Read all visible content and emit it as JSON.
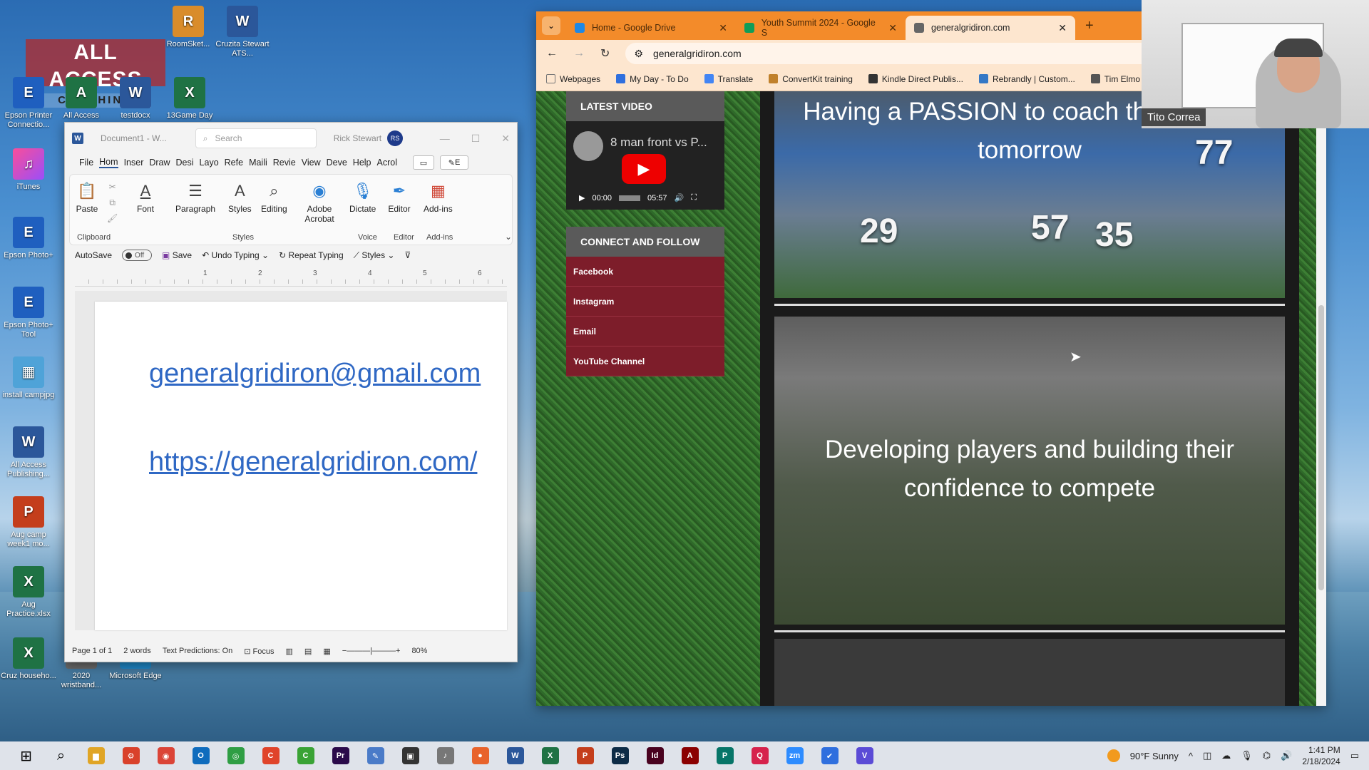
{
  "desktop": {
    "logo": {
      "line1": "ALL ACCESS",
      "line2": "COACHING"
    },
    "icons": [
      {
        "label": "RoomSket...",
        "glyph": "R"
      },
      {
        "label": "Cruzita Stewart ATS...",
        "glyph": "W"
      },
      {
        "label": "Epson Printer Connectio...",
        "glyph": "E"
      },
      {
        "label": "All Access",
        "glyph": "A"
      },
      {
        "label": "testdocx",
        "glyph": "W"
      },
      {
        "label": "13Game Day",
        "glyph": "X"
      },
      {
        "label": "iTunes",
        "glyph": "♫"
      },
      {
        "label": "Epson Photo+",
        "glyph": "E"
      },
      {
        "label": "Epson Photo+ Tool",
        "glyph": "E"
      },
      {
        "label": "install campjpg",
        "glyph": "▦"
      },
      {
        "label": "All Access Publishing...",
        "glyph": "W"
      },
      {
        "label": "Aug camp week1 mo...",
        "glyph": "P"
      },
      {
        "label": "Aug Practice.xlsx",
        "glyph": "X"
      },
      {
        "label": "Cruz househo...",
        "glyph": "X"
      },
      {
        "label": "2020 wristband...",
        "glyph": "▭"
      },
      {
        "label": "Microsoft Edge",
        "glyph": "e"
      }
    ]
  },
  "word": {
    "title": "Document1 - W...",
    "search_placeholder": "Search",
    "user": "Rick Stewart",
    "user_initials": "RS",
    "tabs": [
      "File",
      "Hom",
      "Inser",
      "Draw",
      "Desi",
      "Layo",
      "Refe",
      "Maili",
      "Revie",
      "View",
      "Deve",
      "Help",
      "Acrol"
    ],
    "edit_btn": "E",
    "ribbon": {
      "paste": "Paste",
      "font": "Font",
      "paragraph": "Paragraph",
      "styles": "Styles",
      "editing": "Editing",
      "adobe": "Adobe Acrobat",
      "dictate": "Dictate",
      "editor": "Editor",
      "addins": "Add-ins",
      "group_clipboard": "Clipboard",
      "group_styles": "Styles",
      "group_voice": "Voice",
      "group_editor": "Editor",
      "group_addins": "Add-ins"
    },
    "qat": {
      "autosave": "AutoSave",
      "toggle": "Off",
      "save": "Save",
      "undo": "Undo Typing",
      "repeat": "Repeat Typing",
      "styles": "Styles"
    },
    "ruler": [
      "1",
      "2",
      "3",
      "4",
      "5",
      "6"
    ],
    "doc_lines": [
      "generalgridiron@gmail.com",
      "https://generalgridiron.com/"
    ],
    "status": {
      "page": "Page 1 of 1",
      "words": "2 words",
      "predictions": "Text Predictions: On",
      "focus": "Focus",
      "zoom": "80%"
    }
  },
  "chrome": {
    "tabs": [
      {
        "label": "Home - Google Drive",
        "color": "#1e88e5"
      },
      {
        "label": "Youth Summit 2024 - Google S",
        "color": "#0f9d58"
      },
      {
        "label": "generalgridiron.com",
        "color": "#666666"
      }
    ],
    "url": "generalgridiron.com",
    "bookmarks": [
      {
        "label": "Webpages",
        "color": "#777777"
      },
      {
        "label": "My Day - To Do",
        "color": "#2f6fde"
      },
      {
        "label": "Translate",
        "color": "#4285f4"
      },
      {
        "label": "ConvertKit training",
        "color": "#c0802b"
      },
      {
        "label": "Kindle Direct Publis...",
        "color": "#333333"
      },
      {
        "label": "Rebrandly | Custom...",
        "color": "#3478c6"
      },
      {
        "label": "Tim Elmo",
        "color": "#555555"
      }
    ],
    "site": {
      "latest_video_heading": "LATEST VIDEO",
      "video_title": "8 man front vs P...",
      "video_time": "00:00",
      "video_duration": "05:57",
      "connect_heading": "CONNECT AND FOLLOW",
      "social": [
        "Facebook",
        "Instagram",
        "Email",
        "YouTube Channel"
      ],
      "hero1": "Having a PASSION to coach the youth of tomorrow",
      "hero2": "Developing players and building their confidence to compete",
      "jerseys": [
        "29",
        "57",
        "35",
        "77"
      ]
    }
  },
  "webcam": {
    "name": "Tito Correa"
  },
  "taskbar": {
    "apps": [
      {
        "name": "file-explorer",
        "glyph": "▆",
        "color": "#e0a526"
      },
      {
        "name": "app-red",
        "glyph": "⚙",
        "color": "#d9412b"
      },
      {
        "name": "chrome",
        "glyph": "◉",
        "color": "#db4437"
      },
      {
        "name": "outlook",
        "glyph": "O",
        "color": "#0f6cbd"
      },
      {
        "name": "app-green",
        "glyph": "◎",
        "color": "#2f9e44"
      },
      {
        "name": "app-scribe",
        "glyph": "C",
        "color": "#e0442a"
      },
      {
        "name": "app-camtasia",
        "glyph": "C",
        "color": "#3aa335"
      },
      {
        "name": "premiere",
        "glyph": "Pr",
        "color": "#2a0a4a"
      },
      {
        "name": "app-pen",
        "glyph": "✎",
        "color": "#4a7bc8"
      },
      {
        "name": "app-dark",
        "glyph": "▣",
        "color": "#333333"
      },
      {
        "name": "app-mic",
        "glyph": "♪",
        "color": "#777777"
      },
      {
        "name": "app-orange",
        "glyph": "●",
        "color": "#e8632b"
      },
      {
        "name": "word",
        "glyph": "W",
        "color": "#2b579a"
      },
      {
        "name": "excel",
        "glyph": "X",
        "color": "#1f7244"
      },
      {
        "name": "powerpoint",
        "glyph": "P",
        "color": "#c43e1c"
      },
      {
        "name": "photoshop",
        "glyph": "Ps",
        "color": "#0c2b46"
      },
      {
        "name": "indesign",
        "glyph": "Id",
        "color": "#49021f"
      },
      {
        "name": "acrobat",
        "glyph": "A",
        "color": "#8b0000"
      },
      {
        "name": "publisher",
        "glyph": "P",
        "color": "#077568"
      },
      {
        "name": "app-q",
        "glyph": "Q",
        "color": "#d6224c"
      },
      {
        "name": "zoom",
        "glyph": "zm",
        "color": "#2d8cff"
      },
      {
        "name": "app-todo",
        "glyph": "✔",
        "color": "#2f6fde"
      },
      {
        "name": "app-v",
        "glyph": "V",
        "color": "#5b4bd6"
      }
    ],
    "weather": "90°F  Sunny",
    "time": "1:41 PM",
    "date": "2/18/2024"
  }
}
